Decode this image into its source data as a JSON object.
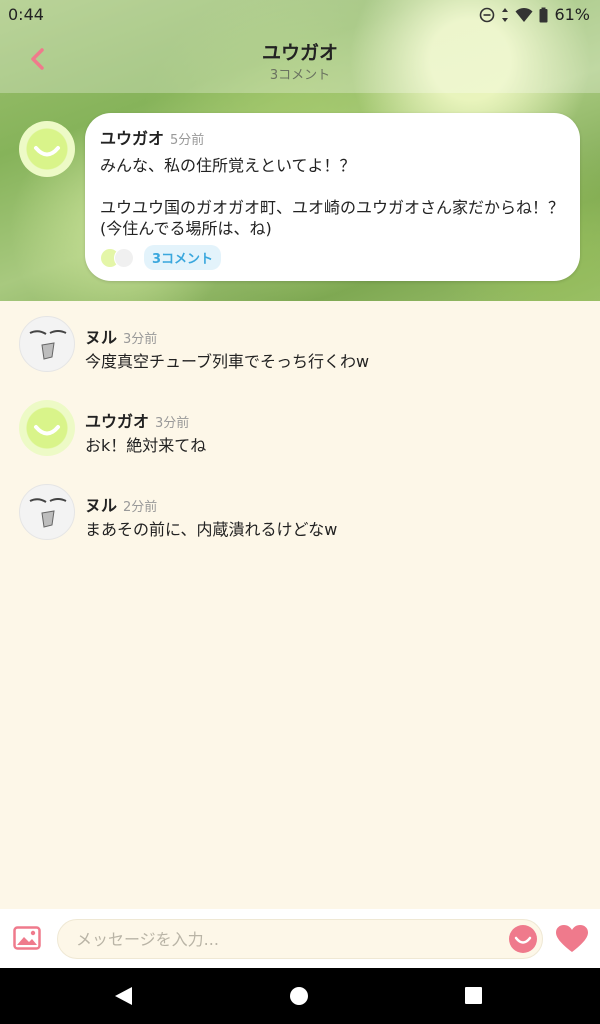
{
  "status_bar": {
    "time": "0:44",
    "battery": "61%"
  },
  "header": {
    "title": "ユウガオ",
    "subtitle": "3コメント"
  },
  "post": {
    "author": "ユウガオ",
    "time": "5分前",
    "body": "みんな、私の住所覚えといてよ！？\n\nユウユウ国のガオガオ町、ユオ崎のユウガオさん家だからね！？(今住んでる場所は、ね)",
    "comment_count_label": "3コメント"
  },
  "comments": [
    {
      "author": "ヌル",
      "time": "3分前",
      "text": "今度真空チューブ列車でそっち行くわw"
    },
    {
      "author": "ユウガオ",
      "time": "3分前",
      "text": "おk！絶対来てね"
    },
    {
      "author": "ヌル",
      "time": "2分前",
      "text": "まあその前に、内蔵潰れるけどなw"
    }
  ],
  "input": {
    "placeholder": "メッセージを入力..."
  },
  "colors": {
    "accent": "#ef7a8c",
    "link": "#3aa7dd",
    "background": "#fdf7e8"
  },
  "icons": {
    "back": "chevron-left-icon",
    "image": "image-icon",
    "emoji": "smile-icon",
    "heart": "heart-icon",
    "nav_back": "triangle-back-icon",
    "nav_home": "circle-home-icon",
    "nav_recent": "square-recent-icon"
  }
}
